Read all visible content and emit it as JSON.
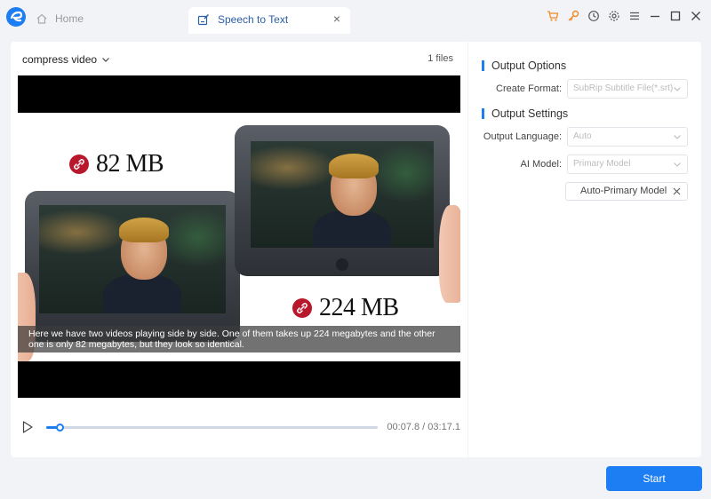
{
  "titlebar": {
    "tabs": [
      {
        "label": "Home",
        "active": false
      },
      {
        "label": "Speech to Text",
        "active": true
      }
    ],
    "icons": [
      "cart-icon",
      "key-icon",
      "history-icon",
      "settings-icon",
      "menu-icon",
      "minimize-icon",
      "maximize-icon",
      "close-icon"
    ]
  },
  "left": {
    "preset": "compress video",
    "files_count": "1 files",
    "video": {
      "size_small": "82 MB",
      "size_large": "224 MB",
      "subtitle": "Here we have two videos playing side by side. One of them takes up 224 megabytes and the other one is only 82 megabytes, but they look so identical."
    },
    "player": {
      "time": "00:07.8 / 03:17.1",
      "progress_fraction": 0.04
    }
  },
  "right": {
    "output_options_title": "Output Options",
    "create_format_label": "Create Format:",
    "create_format_value": "SubRip Subtitle File(*.srt)",
    "output_settings_title": "Output Settings",
    "output_language_label": "Output Language:",
    "output_language_value": "Auto",
    "ai_model_label": "AI Model:",
    "ai_model_value": "Primary Model",
    "selected_chip": "Auto-Primary Model"
  },
  "actions": {
    "start_label": "Start"
  },
  "colors": {
    "accent": "#1d7df2",
    "badge": "#b8182b",
    "tab_active_text": "#2b5fa8"
  }
}
